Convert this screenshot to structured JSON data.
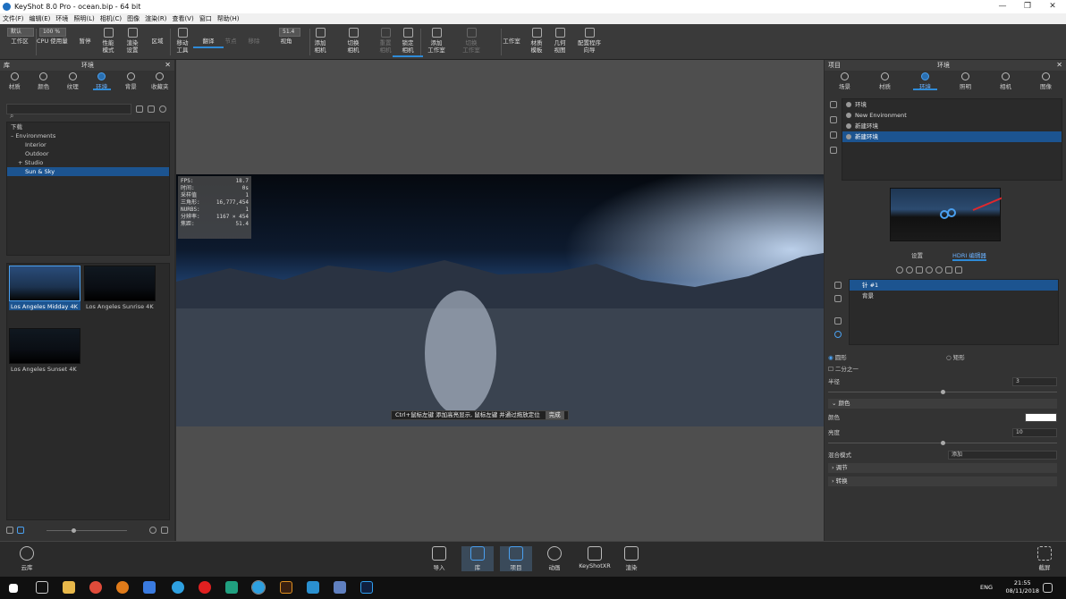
{
  "window": {
    "title": "KeyShot 8.0 Pro - ocean.bip - 64 bit",
    "min": "—",
    "max": "❐",
    "close": "✕"
  },
  "menu": [
    "文件(F)",
    "编辑(E)",
    "环境",
    "照明(L)",
    "相机(C)",
    "图像",
    "渲染(R)",
    "查看(V)",
    "窗口",
    "帮助(H)"
  ],
  "toolbar": {
    "workspace_field": "默认",
    "zoom_field": "100 %",
    "items": [
      {
        "label": "工作区",
        "state": "normal"
      },
      {
        "label": "CPU 使用量",
        "state": "normal"
      },
      {
        "label": "暂停",
        "state": "normal"
      },
      {
        "label": "性能\n模式",
        "state": "normal"
      },
      {
        "label": "渲染\n设置",
        "state": "normal"
      },
      {
        "label": "区域",
        "state": "normal"
      },
      {
        "label": "移动\n工具",
        "state": "normal"
      },
      {
        "label": "翻译",
        "state": "active"
      },
      {
        "label": "节点",
        "state": "dim"
      },
      {
        "label": "移除",
        "state": "dim"
      },
      {
        "label": "视角",
        "state": "normal"
      },
      {
        "label": "添加\n相机",
        "state": "normal"
      },
      {
        "label": "切换\n相机",
        "state": "normal"
      },
      {
        "label": "重置\n相机",
        "state": "dim"
      },
      {
        "label": "锁定\n相机",
        "state": "active"
      },
      {
        "label": "添加\n工作室",
        "state": "normal"
      },
      {
        "label": "切换\n工作室",
        "state": "dim"
      },
      {
        "label": "工作室",
        "state": "normal"
      },
      {
        "label": "材质\n模板",
        "state": "normal"
      },
      {
        "label": "几何\n视图",
        "state": "normal"
      },
      {
        "label": "配置程序\n向导",
        "state": "normal"
      }
    ],
    "lens_value": "51.4"
  },
  "library": {
    "header": "库",
    "title": "环境",
    "tabs": [
      {
        "label": "材质"
      },
      {
        "label": "颜色"
      },
      {
        "label": "纹理"
      },
      {
        "label": "环境",
        "active": true
      },
      {
        "label": "背景"
      },
      {
        "label": "收藏夹"
      }
    ],
    "tree": [
      {
        "label": "下载",
        "indent": 0
      },
      {
        "label": "Environments",
        "indent": 0,
        "prefix": "–"
      },
      {
        "label": "Interior",
        "indent": 2
      },
      {
        "label": "Outdoor",
        "indent": 2
      },
      {
        "label": "Studio",
        "indent": 1,
        "prefix": "+"
      },
      {
        "label": "Sun & Sky",
        "indent": 2,
        "selected": true
      }
    ],
    "thumbs": [
      {
        "label": "Los Angeles Midday 4K",
        "selected": true
      },
      {
        "label": "Los Angeles Sunrise 4K"
      },
      {
        "label": "Los Angeles Sunset 4K"
      }
    ]
  },
  "viewport": {
    "hud": [
      [
        "FPS:",
        "18.7"
      ],
      [
        "时间:",
        "0s"
      ],
      [
        "采样值",
        "1"
      ],
      [
        "三角形:",
        "16,777,454"
      ],
      [
        "NURBS:",
        "1"
      ],
      [
        "分辨率:",
        "1167 × 454"
      ],
      [
        "焦距:",
        "51.4"
      ]
    ],
    "hint_text": "Ctrl+鼠标左键 添加高亮显示, 鼠标左键 并通过拖放定位",
    "hint_done": "完成"
  },
  "project": {
    "header": "项目",
    "title": "环境",
    "tabs": [
      {
        "label": "场景"
      },
      {
        "label": "材质"
      },
      {
        "label": "环境",
        "active": true
      },
      {
        "label": "照明"
      },
      {
        "label": "相机"
      },
      {
        "label": "图像"
      }
    ],
    "envs": [
      {
        "label": "环境"
      },
      {
        "label": "New Environment"
      },
      {
        "label": "新建环境"
      },
      {
        "label": "新建环境",
        "selected": true
      }
    ],
    "subtabs": [
      "设置",
      "HDRI 编辑器"
    ],
    "layers": [
      {
        "label": "针 #1",
        "selected": true
      },
      {
        "label": "背景"
      }
    ],
    "shape_circle": "圆形",
    "shape_rect": "矩形",
    "half": "二分之一",
    "radius_label": "半径",
    "radius_value": "3",
    "color_section": "颜色",
    "color_label": "颜色",
    "brightness_label": "亮度",
    "brightness_value": "10",
    "blend_label": "混合模式",
    "blend_value": "添加",
    "adjust_section": "调节",
    "transform_section": "转换"
  },
  "bottom": {
    "cloud": "云库",
    "import": "导入",
    "library": "库",
    "project": "项目",
    "animation": "动画",
    "keyshotxr": "KeyShotXR",
    "render": "渲染",
    "fullscreen": "截屏"
  },
  "taskbar": {
    "lang": "ENG",
    "time": "21:55",
    "date": "08/11/2018"
  },
  "colors": {
    "accent": "#2e8bd8",
    "selection": "#1c5490",
    "arrow": "#e0282d"
  }
}
